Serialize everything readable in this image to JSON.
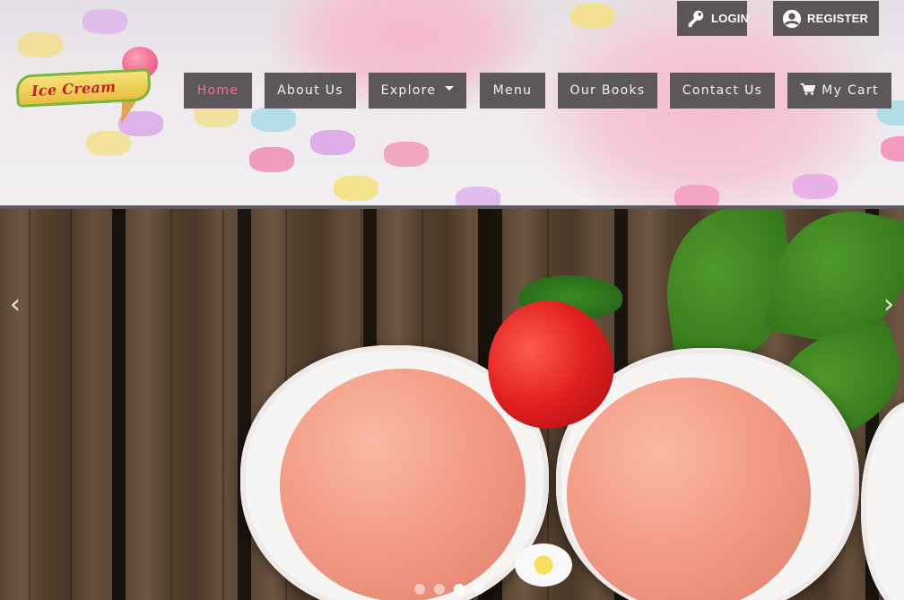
{
  "auth": {
    "login_label": "LOGIN",
    "register_label": "REGISTER"
  },
  "logo": {
    "text": "Ice Cream"
  },
  "nav": {
    "items": [
      {
        "label": "Home",
        "active": true
      },
      {
        "label": "About Us"
      },
      {
        "label": "Explore",
        "dropdown": true
      },
      {
        "label": "Menu"
      },
      {
        "label": "Our Books"
      },
      {
        "label": "Contact Us"
      },
      {
        "label": "My Cart",
        "icon": "cart-icon"
      }
    ]
  },
  "carousel": {
    "prev_label": "‹",
    "next_label": "›",
    "slide_count": 4,
    "active_slide": 3
  },
  "colors": {
    "nav_bg": "#5c5759",
    "nav_active_text": "#ef6f9b",
    "nav_text": "#f3f3f3"
  }
}
